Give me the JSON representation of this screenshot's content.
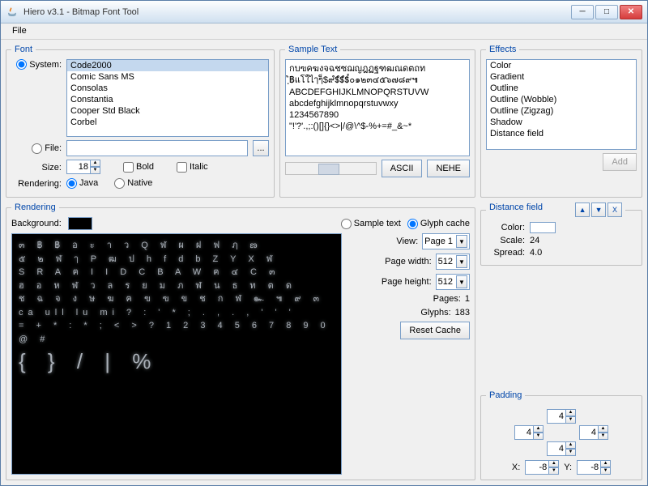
{
  "window": {
    "title": "Hiero v3.1 - Bitmap Font Tool"
  },
  "menubar": {
    "file": "File"
  },
  "font": {
    "legend": "Font",
    "system_label": "System:",
    "file_label": "File:",
    "size_label": "Size:",
    "size_value": "18",
    "bold_label": "Bold",
    "italic_label": "Italic",
    "rendering_label": "Rendering:",
    "java_label": "Java",
    "native_label": "Native",
    "browse": "...",
    "list": [
      "Code2000",
      "Comic Sans MS",
      "Consolas",
      "Constantia",
      "Cooper Std Black",
      "Corbel"
    ]
  },
  "sample": {
    "legend": "Sample Text",
    "line1": "กบฃคฆงจฉชซฌญฎฏฐฑฒณดตถท",
    "line2": "ิฺ฿แโใไๅๆ็$๙ํ$ํ$ํ$๎๐๑๒๓๔๕๖๗๘๙๚",
    "line3": "ABCDEFGHIJKLMNOPQRSTUVW",
    "line4": "abcdefghijklmnopqrstuvwxy",
    "line5": "1234567890",
    "line6": "\"!'?'.,;:()[]{}<>|/@\\^$-%+=#_&~*",
    "ascii": "ASCII",
    "nehe": "NEHE"
  },
  "effects": {
    "legend": "Effects",
    "items": [
      "Color",
      "Gradient",
      "Outline",
      "Outline (Wobble)",
      "Outline (Zigzag)",
      "Shadow",
      "Distance field"
    ],
    "add": "Add"
  },
  "df": {
    "legend": "Distance field",
    "color_label": "Color:",
    "scale_label": "Scale:",
    "scale_value": "24",
    "spread_label": "Spread:",
    "spread_value": "4.0"
  },
  "rendering": {
    "legend": "Rendering",
    "background": "Background:",
    "sample_text": "Sample text",
    "glyph_cache": "Glyph cache",
    "view": "View:",
    "view_value": "Page 1",
    "pw": "Page width:",
    "pw_value": "512",
    "ph": "Page height:",
    "ph_value": "512",
    "pages": "Pages:",
    "pages_value": "1",
    "glyphs": "Glyphs:",
    "glyphs_value": "183",
    "reset": "Reset Cache",
    "canvas1": "๓ ฿ ฿ อ ะ า ว Q ฬ ผ ฝ ฟ ฦ ణ",
    "canvas2": "๕ ๒ ฬ ๅ P ฒ ป h f d b Z Y X ฬ",
    "canvas3": "S R A ฅ I I D C B A W ฅ ๔ C ๓",
    "canvas4": "ฮ อ ห ฬ ว ล ร ย ม ภ ฬ น ธ ท ต ด",
    "canvas5": "ช ฉ จ ง ษ ฆ ฅ ฃ ฃ ข ช ก ฬ ๛ ๚ ๙ ๓",
    "canvas6": "ca ull lu mi ? : ' * ; . , . , ' ' '",
    "canvas7": "= + * : * ; < > ? 1 2 3 4 5 6 7 8 9 0 @ #",
    "canvas8": "{ } / | %"
  },
  "padding": {
    "legend": "Padding",
    "top": "4",
    "left": "4",
    "right": "4",
    "bottom": "4",
    "x_label": "X:",
    "x_value": "-8",
    "y_label": "Y:",
    "y_value": "-8"
  }
}
